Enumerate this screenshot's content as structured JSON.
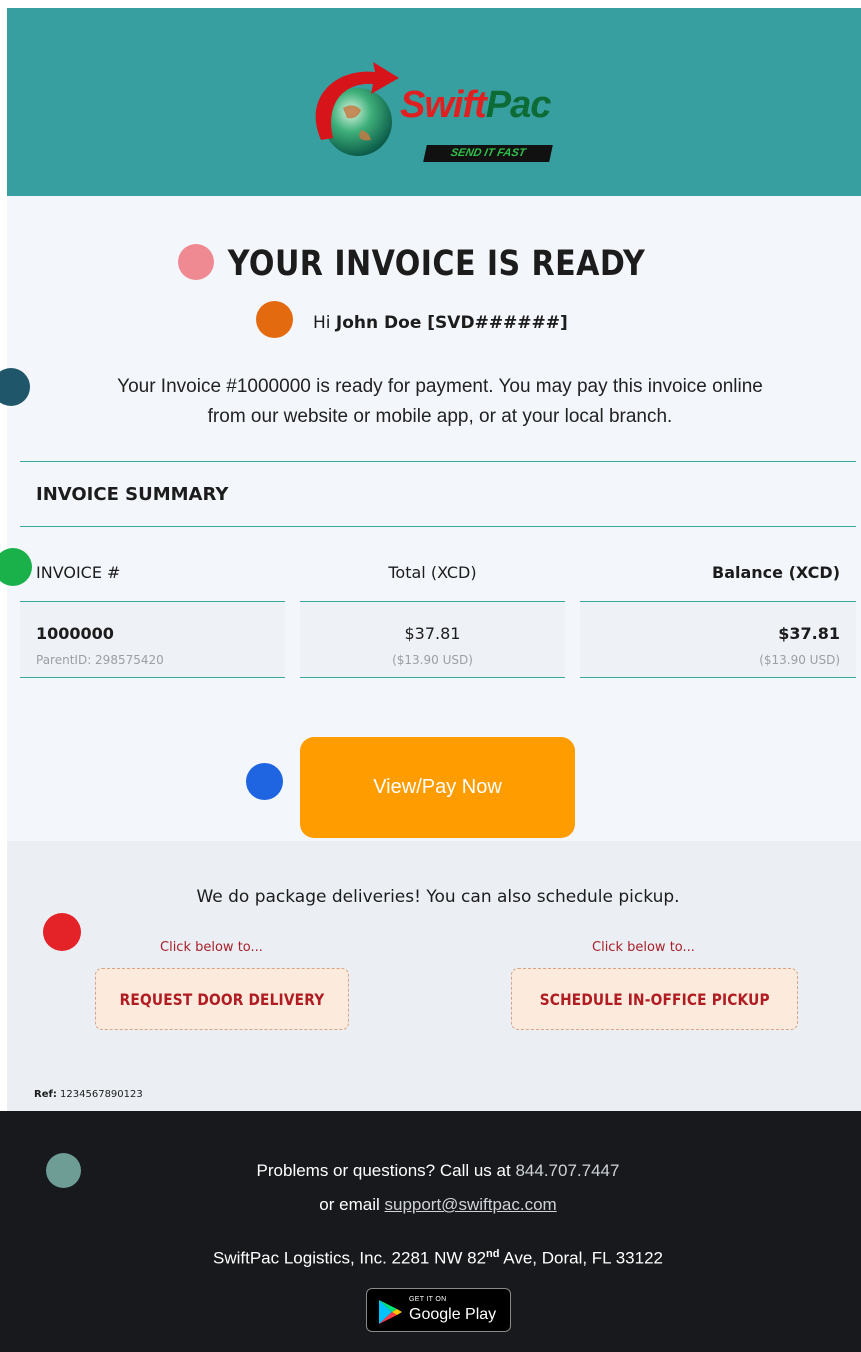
{
  "header": {
    "logo_name": "SwiftPac",
    "logo_tagline": "SEND IT FAST",
    "background_color": "#389fa1"
  },
  "main": {
    "title": "YOUR INVOICE IS READY",
    "greeting_prefix": "Hi",
    "customer": "John Doe [SVD######]",
    "intro_line1": "Your Invoice #1000000 is ready for payment. You may pay this invoice online",
    "intro_line2": "from our website or mobile app, or at your local branch."
  },
  "summary": {
    "title": "INVOICE SUMMARY",
    "columns": [
      "INVOICE #",
      "Total (XCD)",
      "Balance (XCD)"
    ],
    "invoice_number": "1000000",
    "parent_id": "ParentID: 298575420",
    "total": "$37.81",
    "total_usd": "($13.90 USD)",
    "balance": "$37.81",
    "balance_usd": "($13.90 USD)"
  },
  "pay_button": {
    "label": "View/Pay Now",
    "color": "#ff9c00"
  },
  "delivery": {
    "text": "We do package deliveries! You can also schedule pickup.",
    "click_below_left": "Click below to...",
    "click_below_right": "Click below to...",
    "door_delivery_label": "REQUEST DOOR DELIVERY",
    "pickup_label": "SCHEDULE IN-OFFICE PICKUP"
  },
  "ref": {
    "label": "Ref:",
    "value": "1234567890123"
  },
  "footer": {
    "problems_text": "Problems or questions? Call us at",
    "phone": "844.707.7447",
    "email_prefix": "or email",
    "email": "support@swiftpac.com",
    "address_before": "SwiftPac Logistics, Inc. 2281 NW 82",
    "address_sup": "nd",
    "address_after": "Ave, Doral, FL 33122",
    "google_play_small": "GET IT ON",
    "google_play_big": "Google Play"
  },
  "markers": {
    "colors": [
      "#f08a92",
      "#e46a10",
      "#20566a",
      "#1ab04a",
      "#1f64e0",
      "#e42328",
      "#6e9d96"
    ]
  }
}
